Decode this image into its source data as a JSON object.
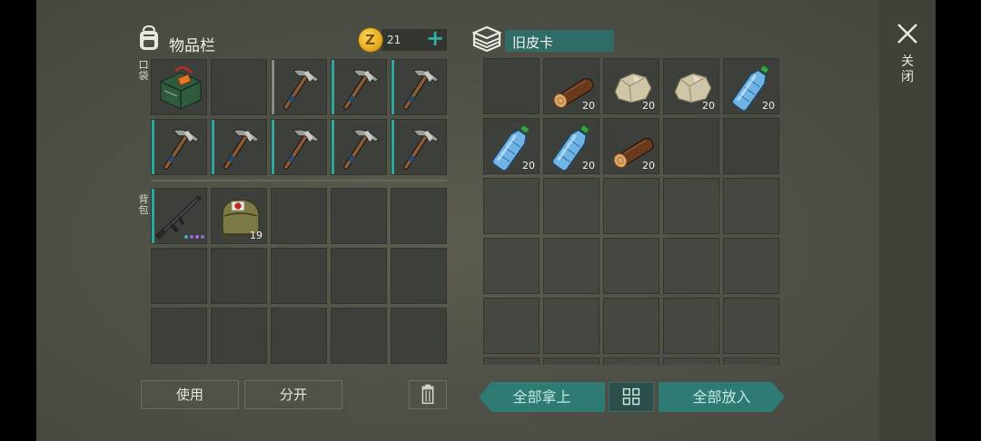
{
  "inventory": {
    "title": "物品栏",
    "coins": "21",
    "add_icon": "plus-icon",
    "pocket_label": "口袋",
    "backpack_label": "背包",
    "pocket_slots": [
      {
        "item": "supply-crate",
        "bar": "none",
        "qty": ""
      },
      {
        "item": "",
        "bar": "none",
        "qty": ""
      },
      {
        "item": "pickaxe",
        "bar": "gray",
        "qty": ""
      },
      {
        "item": "pickaxe",
        "bar": "teal",
        "qty": ""
      },
      {
        "item": "pickaxe",
        "bar": "teal",
        "qty": ""
      },
      {
        "item": "pickaxe",
        "bar": "teal",
        "qty": ""
      },
      {
        "item": "pickaxe",
        "bar": "teal",
        "qty": ""
      },
      {
        "item": "pickaxe",
        "bar": "teal",
        "qty": ""
      },
      {
        "item": "pickaxe",
        "bar": "teal",
        "qty": ""
      },
      {
        "item": "pickaxe",
        "bar": "teal",
        "qty": ""
      }
    ],
    "backpack_slots": [
      {
        "item": "assault-rifle",
        "bar": "teal",
        "qty": "",
        "dots": [
          "#4aa0c8",
          "#8a6ad8",
          "#b06ad8",
          "#8a6ad8"
        ]
      },
      {
        "item": "medkit-bag",
        "bar": "none",
        "qty": "19"
      },
      {
        "item": ""
      },
      {
        "item": ""
      },
      {
        "item": ""
      },
      {
        "item": ""
      },
      {
        "item": ""
      },
      {
        "item": ""
      },
      {
        "item": ""
      },
      {
        "item": ""
      },
      {
        "item": ""
      },
      {
        "item": ""
      },
      {
        "item": ""
      },
      {
        "item": ""
      },
      {
        "item": ""
      }
    ],
    "buttons": {
      "use": "使用",
      "split": "分开",
      "trash_icon": "trash-icon"
    }
  },
  "container": {
    "title": "旧皮卡",
    "icon": "box-icon",
    "slots": [
      {
        "item": "",
        "qty": ""
      },
      {
        "item": "log",
        "qty": "20"
      },
      {
        "item": "stone",
        "qty": "20"
      },
      {
        "item": "stone",
        "qty": "20"
      },
      {
        "item": "water-bottle",
        "qty": "20"
      },
      {
        "item": "water-bottle",
        "qty": "20"
      },
      {
        "item": "water-bottle",
        "qty": "20"
      },
      {
        "item": "log",
        "qty": "20"
      },
      {
        "item": "",
        "qty": ""
      },
      {
        "item": "",
        "qty": ""
      },
      {
        "item": ""
      },
      {
        "item": ""
      },
      {
        "item": ""
      },
      {
        "item": ""
      },
      {
        "item": ""
      },
      {
        "item": ""
      },
      {
        "item": ""
      },
      {
        "item": ""
      },
      {
        "item": ""
      },
      {
        "item": ""
      },
      {
        "item": ""
      },
      {
        "item": ""
      },
      {
        "item": ""
      },
      {
        "item": ""
      },
      {
        "item": ""
      },
      {
        "item": ""
      },
      {
        "item": ""
      },
      {
        "item": ""
      },
      {
        "item": ""
      },
      {
        "item": ""
      }
    ],
    "take_all": "全部拿上",
    "put_all": "全部放入",
    "sort_icon": "grid-sort-icon"
  },
  "close": {
    "icon": "close-icon",
    "label": "关闭"
  },
  "colors": {
    "accent": "#2fa79d",
    "panel": "#4f5046",
    "slot": "#3d403a"
  }
}
